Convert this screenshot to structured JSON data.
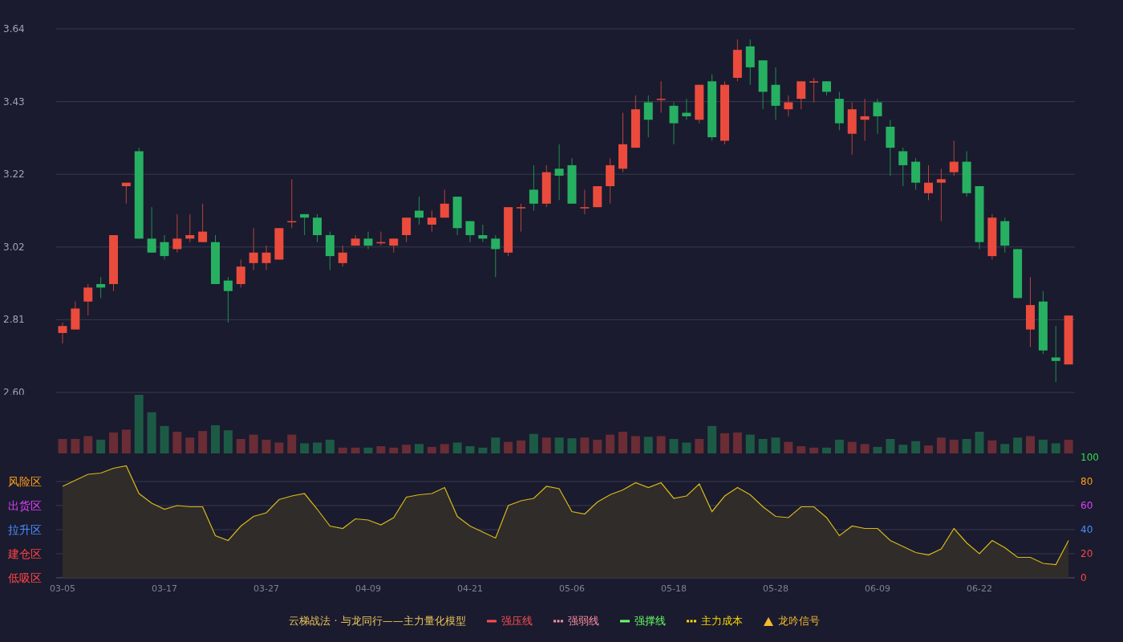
{
  "price_chart": {
    "chart_data": {
      "type": "candlestick",
      "categories": [
        null,
        null,
        null,
        null,
        null,
        null,
        null,
        null,
        null,
        null,
        null,
        null,
        null,
        null,
        null,
        null,
        null,
        null,
        null,
        null,
        null,
        null,
        null,
        null,
        null,
        null,
        null,
        null,
        null,
        null,
        null,
        null,
        null,
        null,
        null,
        null,
        null,
        null,
        null,
        null,
        null,
        null,
        null,
        null,
        null,
        null,
        null,
        null,
        null,
        null,
        null,
        null,
        null,
        null,
        null,
        null,
        null,
        null,
        null,
        null,
        null,
        null,
        null,
        null,
        null,
        null,
        null,
        null,
        null,
        null,
        null,
        null,
        null,
        null,
        null,
        null,
        null,
        null,
        null,
        null
      ],
      "ohlc": [
        [
          2.77,
          2.8,
          2.74,
          2.79
        ],
        [
          2.78,
          2.86,
          2.78,
          2.84
        ],
        [
          2.86,
          2.91,
          2.82,
          2.9
        ],
        [
          2.91,
          2.93,
          2.87,
          2.9
        ],
        [
          2.91,
          3.05,
          2.89,
          3.05
        ],
        [
          3.19,
          3.2,
          3.14,
          3.2
        ],
        [
          3.29,
          3.3,
          3.04,
          3.04
        ],
        [
          3.04,
          3.13,
          3.0,
          3.0
        ],
        [
          3.03,
          3.05,
          2.98,
          2.99
        ],
        [
          3.01,
          3.11,
          3.0,
          3.04
        ],
        [
          3.04,
          3.11,
          3.03,
          3.05
        ],
        [
          3.03,
          3.14,
          3.03,
          3.06
        ],
        [
          3.03,
          3.05,
          2.91,
          2.91
        ],
        [
          2.92,
          2.93,
          2.8,
          2.89
        ],
        [
          2.91,
          2.98,
          2.9,
          2.96
        ],
        [
          2.97,
          3.07,
          2.95,
          3.0
        ],
        [
          2.97,
          3.02,
          2.95,
          3.0
        ],
        [
          2.98,
          3.07,
          2.98,
          3.07
        ],
        [
          3.09,
          3.21,
          3.07,
          3.09
        ],
        [
          3.11,
          3.11,
          3.05,
          3.1
        ],
        [
          3.1,
          3.11,
          3.03,
          3.05
        ],
        [
          3.05,
          3.06,
          2.95,
          2.99
        ],
        [
          2.97,
          3.02,
          2.96,
          3.0
        ],
        [
          3.02,
          3.05,
          3.02,
          3.04
        ],
        [
          3.04,
          3.06,
          3.01,
          3.02
        ],
        [
          3.03,
          3.06,
          3.02,
          3.03
        ],
        [
          3.02,
          3.04,
          3.0,
          3.04
        ],
        [
          3.05,
          3.1,
          3.03,
          3.1
        ],
        [
          3.12,
          3.16,
          3.08,
          3.1
        ],
        [
          3.08,
          3.12,
          3.06,
          3.1
        ],
        [
          3.1,
          3.18,
          3.1,
          3.14
        ],
        [
          3.16,
          3.16,
          3.05,
          3.07
        ],
        [
          3.09,
          3.09,
          3.03,
          3.05
        ],
        [
          3.05,
          3.08,
          3.03,
          3.04
        ],
        [
          3.04,
          3.05,
          2.93,
          3.01
        ],
        [
          3.0,
          3.13,
          2.99,
          3.13
        ],
        [
          3.13,
          3.14,
          3.06,
          3.13
        ],
        [
          3.18,
          3.25,
          3.12,
          3.14
        ],
        [
          3.14,
          3.25,
          3.13,
          3.23
        ],
        [
          3.24,
          3.31,
          3.15,
          3.22
        ],
        [
          3.25,
          3.27,
          3.14,
          3.14
        ],
        [
          3.13,
          3.18,
          3.11,
          3.13
        ],
        [
          3.13,
          3.19,
          3.13,
          3.19
        ],
        [
          3.19,
          3.27,
          3.14,
          3.25
        ],
        [
          3.24,
          3.4,
          3.23,
          3.31
        ],
        [
          3.3,
          3.45,
          3.3,
          3.41
        ],
        [
          3.43,
          3.45,
          3.33,
          3.38
        ],
        [
          3.44,
          3.49,
          3.4,
          3.44
        ],
        [
          3.42,
          3.43,
          3.31,
          3.37
        ],
        [
          3.4,
          3.44,
          3.38,
          3.39
        ],
        [
          3.38,
          3.48,
          3.37,
          3.48
        ],
        [
          3.49,
          3.51,
          3.32,
          3.33
        ],
        [
          3.32,
          3.49,
          3.31,
          3.48
        ],
        [
          3.5,
          3.61,
          3.49,
          3.58
        ],
        [
          3.59,
          3.61,
          3.48,
          3.53
        ],
        [
          3.55,
          3.55,
          3.41,
          3.46
        ],
        [
          3.48,
          3.53,
          3.38,
          3.42
        ],
        [
          3.41,
          3.45,
          3.39,
          3.43
        ],
        [
          3.44,
          3.49,
          3.41,
          3.49
        ],
        [
          3.49,
          3.5,
          3.43,
          3.49
        ],
        [
          3.49,
          3.49,
          3.45,
          3.46
        ],
        [
          3.44,
          3.46,
          3.35,
          3.37
        ],
        [
          3.34,
          3.43,
          3.28,
          3.41
        ],
        [
          3.38,
          3.44,
          3.32,
          3.39
        ],
        [
          3.43,
          3.44,
          3.34,
          3.39
        ],
        [
          3.36,
          3.38,
          3.22,
          3.3
        ],
        [
          3.29,
          3.3,
          3.19,
          3.25
        ],
        [
          3.26,
          3.27,
          3.18,
          3.2
        ],
        [
          3.17,
          3.25,
          3.15,
          3.2
        ],
        [
          3.2,
          3.24,
          3.09,
          3.21
        ],
        [
          3.23,
          3.32,
          3.22,
          3.26
        ],
        [
          3.26,
          3.29,
          3.16,
          3.17
        ],
        [
          3.19,
          3.19,
          3.01,
          3.03
        ],
        [
          2.99,
          3.11,
          2.98,
          3.1
        ],
        [
          3.09,
          3.1,
          3.0,
          3.02
        ],
        [
          3.01,
          3.01,
          2.87,
          2.87
        ],
        [
          2.78,
          2.93,
          2.73,
          2.85
        ],
        [
          2.86,
          2.89,
          2.71,
          2.72
        ],
        [
          2.7,
          2.79,
          2.63,
          2.69
        ],
        [
          2.68,
          2.82,
          2.68,
          2.82
        ]
      ],
      "ylim": [
        2.6,
        3.64
      ],
      "grid": true,
      "yticks": [
        {
          "value": 2.6,
          "label": "2.60"
        },
        {
          "value": 2.808,
          "label": "2.81"
        },
        {
          "value": 3.016,
          "label": "3.02"
        },
        {
          "value": 3.224,
          "label": "3.22"
        },
        {
          "value": 3.432,
          "label": "3.43"
        },
        {
          "value": 3.64,
          "label": "3.64"
        }
      ]
    }
  },
  "indicator_chart": {
    "zone_labels": [
      {
        "label": "风险区",
        "color": "#ff9f1a"
      },
      {
        "label": "出货区",
        "color": "#e040fb"
      },
      {
        "label": "拉升区",
        "color": "#4a8cff"
      },
      {
        "label": "建仓区",
        "color": "#ff4444"
      },
      {
        "label": "低吸区",
        "color": "#ff4444"
      }
    ],
    "tick_colors": [
      {
        "color": "#ff4444"
      },
      {
        "color": "#ff4444"
      },
      {
        "color": "#4a8cff"
      },
      {
        "color": "#e040fb"
      },
      {
        "color": "#ff9f1a"
      },
      {
        "color": "#33dd55"
      }
    ],
    "chart_data": {
      "type": "area",
      "categories": [
        "03-05",
        null,
        null,
        null,
        null,
        null,
        null,
        null,
        "03-17",
        null,
        null,
        null,
        null,
        null,
        null,
        null,
        "03-27",
        null,
        null,
        null,
        null,
        null,
        null,
        null,
        "04-09",
        null,
        null,
        null,
        null,
        null,
        null,
        null,
        "04-21",
        null,
        null,
        null,
        null,
        null,
        null,
        null,
        "05-06",
        null,
        null,
        null,
        null,
        null,
        null,
        null,
        "05-18",
        null,
        null,
        null,
        null,
        null,
        null,
        null,
        "05-28",
        null,
        null,
        null,
        null,
        null,
        null,
        null,
        "06-09",
        null,
        null,
        null,
        null,
        null,
        null,
        null,
        "06-22",
        null,
        null,
        null,
        null,
        null,
        null,
        null
      ],
      "series": [
        {
          "color": "#d8b81a",
          "values": [
            76,
            81,
            86,
            87,
            91,
            93,
            70,
            62,
            57,
            60,
            59,
            59,
            35,
            31,
            43,
            51,
            54,
            65,
            68,
            70,
            57,
            43,
            41,
            49,
            48,
            44,
            50,
            67,
            69,
            70,
            75,
            51,
            43,
            38,
            33,
            60,
            64,
            66,
            76,
            74,
            55,
            53,
            63,
            69,
            73,
            79,
            75,
            79,
            66,
            68,
            78,
            55,
            68,
            75,
            69,
            59,
            51,
            50,
            59,
            59,
            50,
            35,
            43,
            41,
            41,
            31,
            26,
            21,
            19,
            24,
            41,
            29,
            20,
            31,
            25,
            17,
            17,
            12,
            11,
            31
          ]
        }
      ],
      "ylim": [
        0,
        100
      ],
      "grid": true,
      "yticks": [
        0,
        20,
        40,
        60,
        80,
        100
      ]
    }
  },
  "legend": {
    "title": "云梯战法 · 与龙同行——主力量化模型",
    "items": [
      {
        "label": "强压线",
        "kind": "solid",
        "color": "#ff4d4f"
      },
      {
        "label": "强弱线",
        "kind": "dashed",
        "color": "#ff8fa3"
      },
      {
        "label": "强撑线",
        "kind": "solid",
        "color": "#66ff66"
      },
      {
        "label": "主力成本",
        "kind": "dashed",
        "color": "#ffd700"
      },
      {
        "label": "龙吟信号",
        "kind": "triangle",
        "color": "#f5b82e"
      }
    ]
  }
}
